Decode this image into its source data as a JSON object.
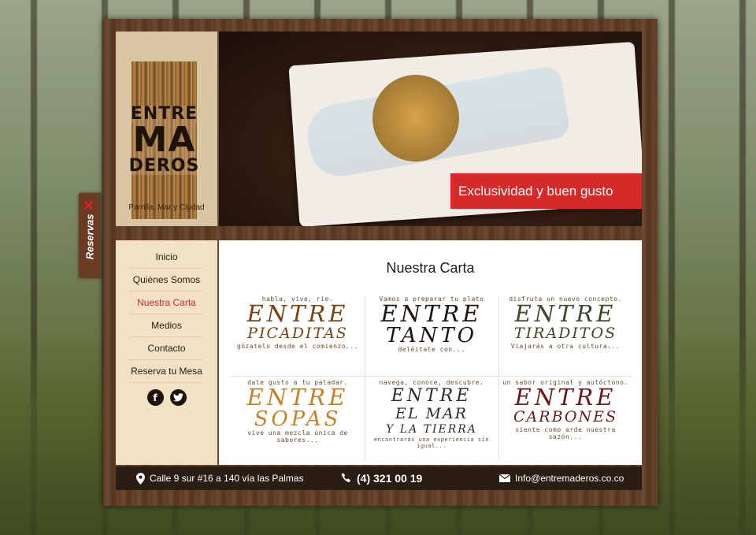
{
  "brand": {
    "logo_line1": "ENTRE",
    "logo_line2": "MA",
    "logo_line3": "DEROS",
    "tagline": "Parrilla, Mar y Ciudad"
  },
  "hero": {
    "caption": "Exclusividad y buen gusto"
  },
  "side_tab": {
    "label": "Reservas",
    "close_glyph": "✕"
  },
  "nav": {
    "items": [
      {
        "label": "Inicio"
      },
      {
        "label": "Quiénes Somos"
      },
      {
        "label": "Nuestra Carta",
        "active": true
      },
      {
        "label": "Medios"
      },
      {
        "label": "Contacto"
      },
      {
        "label": "Reserva tu Mesa"
      }
    ],
    "social": [
      {
        "icon": "facebook-icon",
        "glyph": "f"
      },
      {
        "icon": "twitter-icon",
        "glyph": "t"
      }
    ]
  },
  "content": {
    "title": "Nuestra Carta",
    "cards": [
      {
        "top": "habla, vive, rie.",
        "line1": "ENTRE",
        "line2": "PICADITAS",
        "bottom": "gózatelo desde el comienzo..."
      },
      {
        "top": "Vamos a preparar tu plato",
        "line1": "ENTRE",
        "line2": "TANTO",
        "bottom": "deléitate con..."
      },
      {
        "top": "disfruta un nuevo concepto.",
        "line1": "ENTRE",
        "line2": "TIRADITOS",
        "bottom": "Viajarás a otra cultura..."
      },
      {
        "top": "dale gusto a tu paladar.",
        "line1": "ENTRE",
        "line2": "SOPAS",
        "bottom": "vive una mezcla única de sabores..."
      },
      {
        "top": "navega, conoce, descubre.",
        "line1": "ENTRE",
        "line2": "EL MAR",
        "line3": "Y LA TIERRA",
        "bottom": "encontrarás una experiencia sin igual..."
      },
      {
        "top": "un sabor original y autóctono.",
        "line1": "ENTRE",
        "line2": "CARBONES",
        "bottom": "siente como arde nuestra sazón..."
      }
    ]
  },
  "footer": {
    "address": "Calle 9 sur #16 a 140 vía las Palmas",
    "phone": "(4) 321 00 19",
    "email": "Info@entremaderos.co.co"
  },
  "colors": {
    "accent_red": "#d42a2a",
    "footer_bg": "#2a1d14",
    "nav_bg": "#f3e1c6"
  }
}
